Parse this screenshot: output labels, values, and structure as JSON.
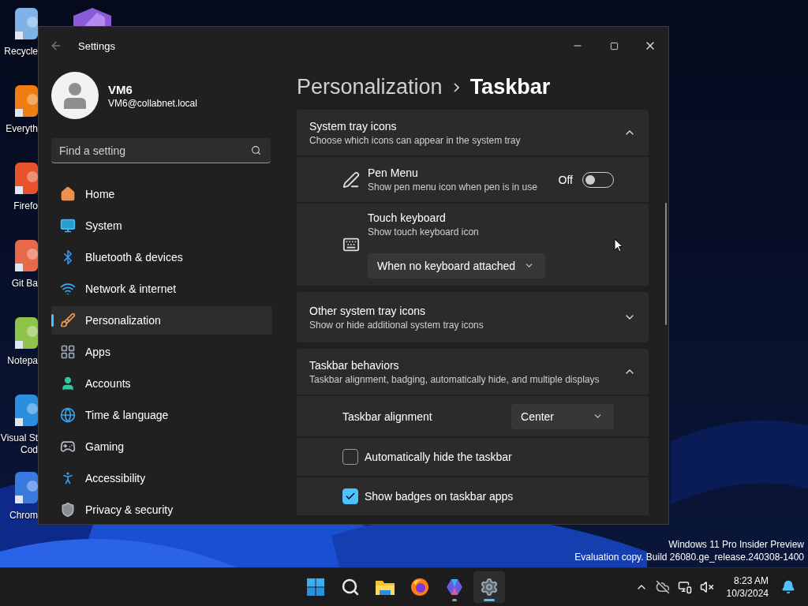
{
  "desktop_icons": [
    {
      "kind": "recycle",
      "lines": [
        "Recycle"
      ]
    },
    {
      "kind": "search-app",
      "lines": [
        "Everyth"
      ]
    },
    {
      "kind": "firefox",
      "lines": [
        "Firefo"
      ]
    },
    {
      "kind": "git",
      "lines": [
        "Git Ba"
      ]
    },
    {
      "kind": "notepad",
      "lines": [
        "Notepa"
      ]
    },
    {
      "kind": "vscode",
      "lines": [
        "Visual St",
        "Cod"
      ]
    },
    {
      "kind": "chrome",
      "lines": [
        "Chrom"
      ]
    }
  ],
  "window": {
    "title": "Settings"
  },
  "user": {
    "name": "VM6",
    "email": "VM6@collabnet.local"
  },
  "search": {
    "placeholder": "Find a setting"
  },
  "nav": [
    {
      "kind": "home",
      "label": "Home",
      "selected": false
    },
    {
      "kind": "system",
      "label": "System",
      "selected": false
    },
    {
      "kind": "bluetooth",
      "label": "Bluetooth & devices",
      "selected": false
    },
    {
      "kind": "network",
      "label": "Network & internet",
      "selected": false
    },
    {
      "kind": "personalization",
      "label": "Personalization",
      "selected": true
    },
    {
      "kind": "apps",
      "label": "Apps",
      "selected": false
    },
    {
      "kind": "accounts",
      "label": "Accounts",
      "selected": false
    },
    {
      "kind": "time",
      "label": "Time & language",
      "selected": false
    },
    {
      "kind": "gaming",
      "label": "Gaming",
      "selected": false
    },
    {
      "kind": "accessibility",
      "label": "Accessibility",
      "selected": false
    },
    {
      "kind": "privacy",
      "label": "Privacy & security",
      "selected": false
    }
  ],
  "breadcrumb": [
    "Personalization",
    "Taskbar"
  ],
  "sections": [
    {
      "title": "System tray icons",
      "subtitle": "Choose which icons can appear in the system tray",
      "expanded": true,
      "rows": [
        {
          "kind": "toggle",
          "title": "Pen Menu",
          "subtitle": "Show pen menu icon when pen is in use",
          "state_label": "Off",
          "on": false
        },
        {
          "kind": "dropdown",
          "title": "Touch keyboard",
          "subtitle": "Show touch keyboard icon",
          "value": "When no keyboard attached"
        }
      ]
    },
    {
      "title": "Other system tray icons",
      "subtitle": "Show or hide additional system tray icons",
      "expanded": false
    },
    {
      "title": "Taskbar behaviors",
      "subtitle": "Taskbar alignment, badging, automatically hide, and multiple displays",
      "expanded": true,
      "rows": [
        {
          "kind": "select",
          "title": "Taskbar alignment",
          "value": "Center"
        },
        {
          "kind": "checkbox",
          "title": "Automatically hide the taskbar",
          "checked": false
        },
        {
          "kind": "checkbox",
          "title": "Show badges on taskbar apps",
          "checked": true
        }
      ]
    }
  ],
  "desktop_text": [
    "Windows 11 Pro Insider Preview",
    "Evaluation copy. Build 26080.ge_release.240308-1400"
  ],
  "taskbar": {
    "apps": [
      {
        "kind": "start",
        "running": false,
        "selected": false
      },
      {
        "kind": "search",
        "running": false,
        "selected": false
      },
      {
        "kind": "explorer",
        "running": false,
        "selected": false
      },
      {
        "kind": "firefox",
        "running": false,
        "selected": false
      },
      {
        "kind": "copilot",
        "running": true,
        "selected": false
      },
      {
        "kind": "settings",
        "running": true,
        "selected": true
      }
    ],
    "clock": {
      "time": "8:23 AM",
      "date": "10/3/2024"
    }
  }
}
